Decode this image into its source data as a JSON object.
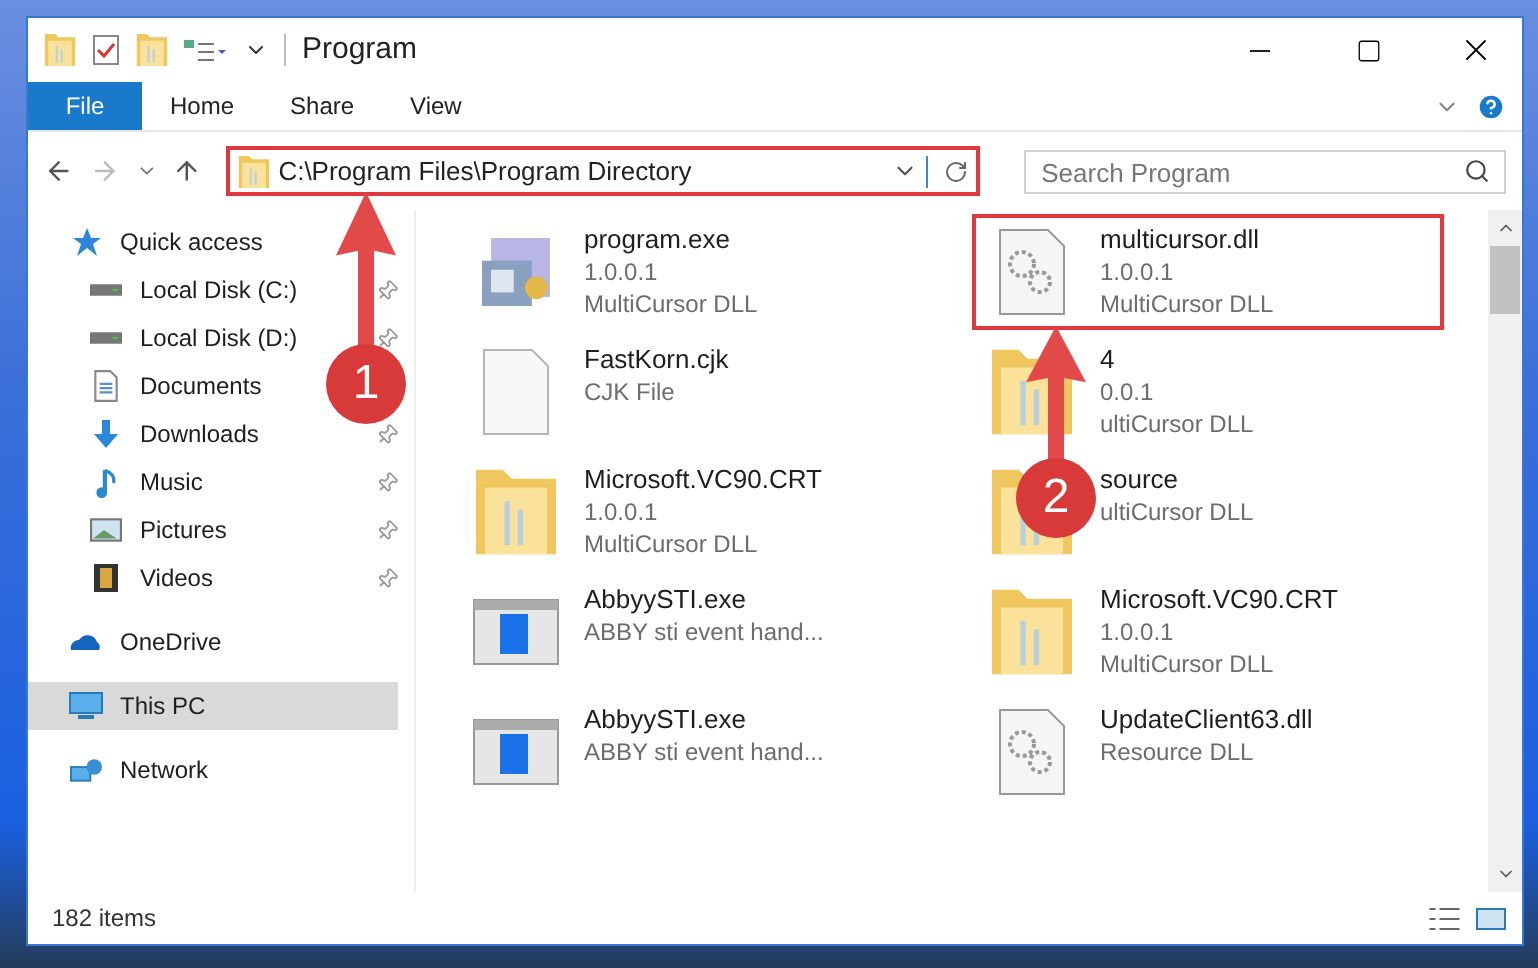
{
  "window": {
    "title": "Program"
  },
  "ribbon_tabs": [
    {
      "label": "File",
      "kind": "file"
    },
    {
      "label": "Home",
      "kind": "tab"
    },
    {
      "label": "Share",
      "kind": "tab"
    },
    {
      "label": "View",
      "kind": "tab"
    }
  ],
  "address_bar": {
    "path": "C:\\Program Files\\Program Directory",
    "highlighted": true
  },
  "search": {
    "placeholder": "Search Program"
  },
  "sidebar": {
    "items": [
      {
        "label": "Quick access",
        "kind": "star",
        "selected": false,
        "children": [
          {
            "label": "Local Disk (C:)",
            "kind": "disk",
            "pinned": true,
            "selected": false
          },
          {
            "label": "Local Disk (D:)",
            "kind": "disk",
            "pinned": true,
            "selected": false
          },
          {
            "label": "Documents",
            "kind": "doc",
            "pinned": false,
            "selected": false
          },
          {
            "label": "Downloads",
            "kind": "download",
            "pinned": true,
            "selected": false
          },
          {
            "label": "Music",
            "kind": "music",
            "pinned": true,
            "selected": false
          },
          {
            "label": "Pictures",
            "kind": "pictures",
            "pinned": true,
            "selected": false
          },
          {
            "label": "Videos",
            "kind": "video",
            "pinned": true,
            "selected": false
          }
        ]
      },
      {
        "label": "OneDrive",
        "kind": "cloud",
        "selected": false
      },
      {
        "label": "This PC",
        "kind": "pc",
        "selected": true
      },
      {
        "label": "Network",
        "kind": "network",
        "selected": false
      }
    ]
  },
  "files": [
    {
      "name": "program.exe",
      "details": [
        "1.0.0.1",
        "MultiCursor DLL"
      ],
      "kind": "exe",
      "highlighted": false
    },
    {
      "name": "multicursor.dll",
      "details": [
        "1.0.0.1",
        "MultiCursor DLL"
      ],
      "kind": "dll",
      "highlighted": true
    },
    {
      "name": "FastKorn.cjk",
      "details": [
        "CJK File"
      ],
      "kind": "blank",
      "highlighted": false
    },
    {
      "name": "4",
      "details": [
        "0.0.1",
        "ultiCursor DLL"
      ],
      "kind": "folder",
      "highlighted": false
    },
    {
      "name": "Microsoft.VC90.CRT",
      "details": [
        "1.0.0.1",
        "MultiCursor DLL"
      ],
      "kind": "folder",
      "highlighted": false
    },
    {
      "name": "source",
      "details": [
        "ultiCursor DLL"
      ],
      "kind": "folder",
      "highlighted": false
    },
    {
      "name": "AbbyySTI.exe",
      "details": [
        "ABBY sti event hand..."
      ],
      "kind": "app",
      "highlighted": false
    },
    {
      "name": "Microsoft.VC90.CRT",
      "details": [
        "1.0.0.1",
        "MultiCursor DLL"
      ],
      "kind": "folder",
      "highlighted": false
    },
    {
      "name": "AbbyySTI.exe",
      "details": [
        "ABBY sti event hand..."
      ],
      "kind": "app",
      "highlighted": false
    },
    {
      "name": "UpdateClient63.dll",
      "details": [
        "Resource DLL"
      ],
      "kind": "dll",
      "highlighted": false
    }
  ],
  "callouts": [
    {
      "number": "1"
    },
    {
      "number": "2"
    }
  ],
  "status_bar": {
    "item_count": "182 items"
  }
}
